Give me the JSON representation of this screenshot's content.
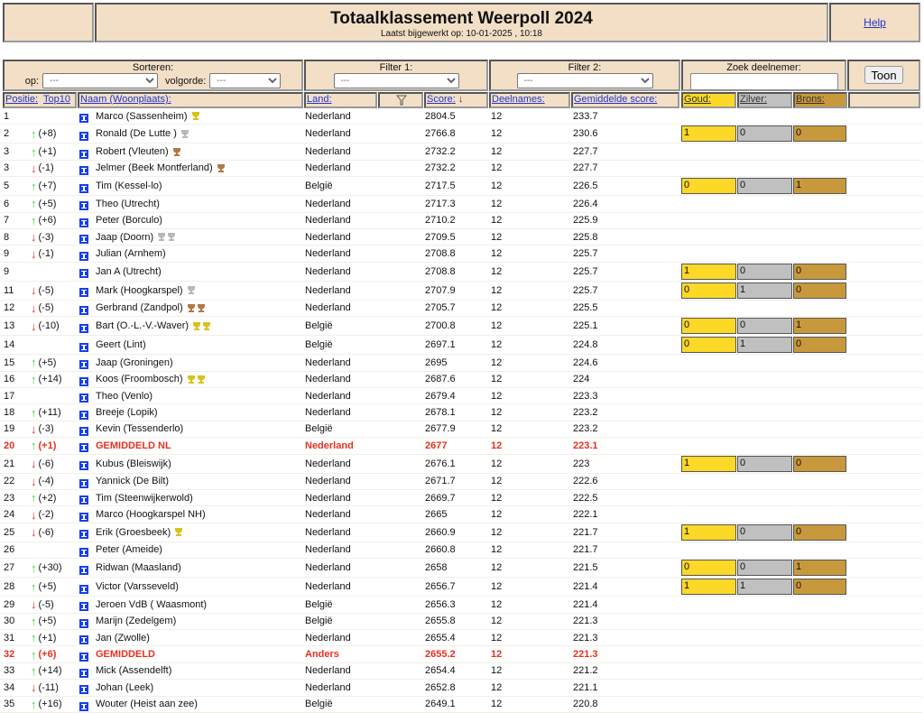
{
  "header": {
    "title": "Totaalklassement Weerpoll 2024",
    "updated": "Laatst bijgewerkt op: 10-01-2025 , 10:18",
    "help": "Help"
  },
  "controls": {
    "sort_label": "Sorteren:",
    "sort_on_label": "op:",
    "sort_on_value": "---",
    "order_label": "volgorde:",
    "order_value": "---",
    "filter1_label": "Filter 1:",
    "filter1_value": "---",
    "filter2_label": "Filter 2:",
    "filter2_value": "---",
    "search_label": "Zoek deelnemer:",
    "search_value": "",
    "show_button": "Toon"
  },
  "columns": {
    "position": "Positie:",
    "top10": "Top10",
    "name": "Naam (Woonplaats):",
    "country": "Land:",
    "score": "Score:",
    "entries": "Deelnames:",
    "avg": "Gemiddelde score:",
    "gold": "Goud:",
    "silver": "Zilver:",
    "bronze": "Brons:"
  },
  "colors": {
    "gold": "#fcd827",
    "silver": "#c0c0c0",
    "bronze": "#c8993c",
    "header_bg": "#f2dfc6",
    "highlight": "#e8301e"
  },
  "rows": [
    {
      "pos": "1",
      "chg": "",
      "name": "Marco (Sassenheim)",
      "land": "Nederland",
      "score": "2804.5",
      "n": "12",
      "avg": "233.7",
      "trophies": [
        "gold"
      ]
    },
    {
      "pos": "2",
      "chg": "(+8)",
      "dir": "up",
      "name": "Ronald (De Lutte )",
      "land": "Nederland",
      "score": "2766.8",
      "n": "12",
      "avg": "230.6",
      "trophies": [
        "silver"
      ],
      "medals": [
        "1",
        "0",
        "0"
      ]
    },
    {
      "pos": "3",
      "chg": "(+1)",
      "dir": "up",
      "name": "Robert (Vleuten)",
      "land": "Nederland",
      "score": "2732.2",
      "n": "12",
      "avg": "227.7",
      "trophies": [
        "bronze"
      ]
    },
    {
      "pos": "3",
      "chg": "(-1)",
      "dir": "down",
      "name": "Jelmer (Beek Montferland)",
      "land": "Nederland",
      "score": "2732.2",
      "n": "12",
      "avg": "227.7",
      "trophies": [
        "bronze"
      ]
    },
    {
      "pos": "5",
      "chg": "(+7)",
      "dir": "up",
      "name": "Tim (Kessel-lo)",
      "land": "België",
      "score": "2717.5",
      "n": "12",
      "avg": "226.5",
      "medals": [
        "0",
        "0",
        "1"
      ]
    },
    {
      "pos": "6",
      "chg": "(+5)",
      "dir": "up",
      "name": "Theo (Utrecht)",
      "land": "Nederland",
      "score": "2717.3",
      "n": "12",
      "avg": "226.4"
    },
    {
      "pos": "7",
      "chg": "(+6)",
      "dir": "up",
      "name": "Peter (Borculo)",
      "land": "Nederland",
      "score": "2710.2",
      "n": "12",
      "avg": "225.9"
    },
    {
      "pos": "8",
      "chg": "(-3)",
      "dir": "down",
      "name": "Jaap (Doorn)",
      "land": "Nederland",
      "score": "2709.5",
      "n": "12",
      "avg": "225.8",
      "trophies": [
        "silver",
        "silver"
      ]
    },
    {
      "pos": "9",
      "chg": "(-1)",
      "dir": "down",
      "name": "Julian (Arnhem)",
      "land": "Nederland",
      "score": "2708.8",
      "n": "12",
      "avg": "225.7"
    },
    {
      "pos": "9",
      "chg": "",
      "name": "Jan A (Utrecht)",
      "land": "Nederland",
      "score": "2708.8",
      "n": "12",
      "avg": "225.7",
      "medals": [
        "1",
        "0",
        "0"
      ]
    },
    {
      "pos": "11",
      "chg": "(-5)",
      "dir": "down",
      "name": "Mark (Hoogkarspel)",
      "land": "Nederland",
      "score": "2707.9",
      "n": "12",
      "avg": "225.7",
      "trophies": [
        "silver"
      ],
      "medals": [
        "0",
        "1",
        "0"
      ]
    },
    {
      "pos": "12",
      "chg": "(-5)",
      "dir": "down",
      "name": "Gerbrand (Zandpol)",
      "land": "Nederland",
      "score": "2705.7",
      "n": "12",
      "avg": "225.5",
      "trophies": [
        "bronze",
        "bronze"
      ]
    },
    {
      "pos": "13",
      "chg": "(-10)",
      "dir": "down",
      "name": "Bart (O.-L.-V.-Waver)",
      "land": "België",
      "score": "2700.8",
      "n": "12",
      "avg": "225.1",
      "trophies": [
        "gold",
        "gold"
      ],
      "medals": [
        "0",
        "0",
        "1"
      ]
    },
    {
      "pos": "14",
      "chg": "",
      "name": "Geert (Lint)",
      "land": "België",
      "score": "2697.1",
      "n": "12",
      "avg": "224.8",
      "medals": [
        "0",
        "1",
        "0"
      ]
    },
    {
      "pos": "15",
      "chg": "(+5)",
      "dir": "up",
      "name": "Jaap (Groningen)",
      "land": "Nederland",
      "score": "2695",
      "n": "12",
      "avg": "224.6"
    },
    {
      "pos": "16",
      "chg": "(+14)",
      "dir": "up",
      "name": "Koos (Froombosch)",
      "land": "Nederland",
      "score": "2687.6",
      "n": "12",
      "avg": "224",
      "trophies": [
        "gold",
        "gold"
      ]
    },
    {
      "pos": "17",
      "chg": "",
      "name": "Theo (Venlo)",
      "land": "Nederland",
      "score": "2679.4",
      "n": "12",
      "avg": "223.3"
    },
    {
      "pos": "18",
      "chg": "(+11)",
      "dir": "up",
      "name": "Breeje (Lopik)",
      "land": "Nederland",
      "score": "2678.1",
      "n": "12",
      "avg": "223.2"
    },
    {
      "pos": "19",
      "chg": "(-3)",
      "dir": "down",
      "name": "Kevin (Tessenderlo)",
      "land": "België",
      "score": "2677.9",
      "n": "12",
      "avg": "223.2"
    },
    {
      "pos": "20",
      "chg": "(+1)",
      "dir": "up",
      "name": "GEMIDDELD NL",
      "land": "Nederland",
      "score": "2677",
      "n": "12",
      "avg": "223.1",
      "highlight": true
    },
    {
      "pos": "21",
      "chg": "(-6)",
      "dir": "down",
      "name": "Kubus (Bleiswijk)",
      "land": "Nederland",
      "score": "2676.1",
      "n": "12",
      "avg": "223",
      "medals": [
        "1",
        "0",
        "0"
      ]
    },
    {
      "pos": "22",
      "chg": "(-4)",
      "dir": "down",
      "name": "Yannick (De Bilt)",
      "land": "Nederland",
      "score": "2671.7",
      "n": "12",
      "avg": "222.6"
    },
    {
      "pos": "23",
      "chg": "(+2)",
      "dir": "up",
      "name": "Tim (Steenwijkerwold)",
      "land": "Nederland",
      "score": "2669.7",
      "n": "12",
      "avg": "222.5"
    },
    {
      "pos": "24",
      "chg": "(-2)",
      "dir": "down",
      "name": "Marco (Hoogkarspel NH)",
      "land": "Nederland",
      "score": "2665",
      "n": "12",
      "avg": "222.1"
    },
    {
      "pos": "25",
      "chg": "(-6)",
      "dir": "down",
      "name": "Erik (Groesbeek)",
      "land": "Nederland",
      "score": "2660.9",
      "n": "12",
      "avg": "221.7",
      "trophies": [
        "gold"
      ],
      "medals": [
        "1",
        "0",
        "0"
      ]
    },
    {
      "pos": "26",
      "chg": "",
      "name": "Peter (Ameide)",
      "land": "Nederland",
      "score": "2660.8",
      "n": "12",
      "avg": "221.7"
    },
    {
      "pos": "27",
      "chg": "(+30)",
      "dir": "up",
      "name": "Ridwan (Maasland)",
      "land": "Nederland",
      "score": "2658",
      "n": "12",
      "avg": "221.5",
      "medals": [
        "0",
        "0",
        "1"
      ]
    },
    {
      "pos": "28",
      "chg": "(+5)",
      "dir": "up",
      "name": "Victor (Varsseveld)",
      "land": "Nederland",
      "score": "2656.7",
      "n": "12",
      "avg": "221.4",
      "medals": [
        "1",
        "1",
        "0"
      ]
    },
    {
      "pos": "29",
      "chg": "(-5)",
      "dir": "down",
      "name": "Jeroen VdB ( Waasmont)",
      "land": "België",
      "score": "2656.3",
      "n": "12",
      "avg": "221.4"
    },
    {
      "pos": "30",
      "chg": "(+5)",
      "dir": "up",
      "name": "Marijn (Zedelgem)",
      "land": "België",
      "score": "2655.8",
      "n": "12",
      "avg": "221.3"
    },
    {
      "pos": "31",
      "chg": "(+1)",
      "dir": "up",
      "name": "Jan (Zwolle)",
      "land": "Nederland",
      "score": "2655.4",
      "n": "12",
      "avg": "221.3"
    },
    {
      "pos": "32",
      "chg": "(+6)",
      "dir": "up",
      "name": "GEMIDDELD",
      "land": "Anders",
      "score": "2655.2",
      "n": "12",
      "avg": "221.3",
      "highlight": true
    },
    {
      "pos": "33",
      "chg": "(+14)",
      "dir": "up",
      "name": "Mick (Assendelft)",
      "land": "Nederland",
      "score": "2654.4",
      "n": "12",
      "avg": "221.2"
    },
    {
      "pos": "34",
      "chg": "(-11)",
      "dir": "down",
      "name": "Johan (Leek)",
      "land": "Nederland",
      "score": "2652.8",
      "n": "12",
      "avg": "221.1"
    },
    {
      "pos": "35",
      "chg": "(+16)",
      "dir": "up",
      "name": "Wouter (Heist aan zee)",
      "land": "België",
      "score": "2649.1",
      "n": "12",
      "avg": "220.8"
    }
  ]
}
